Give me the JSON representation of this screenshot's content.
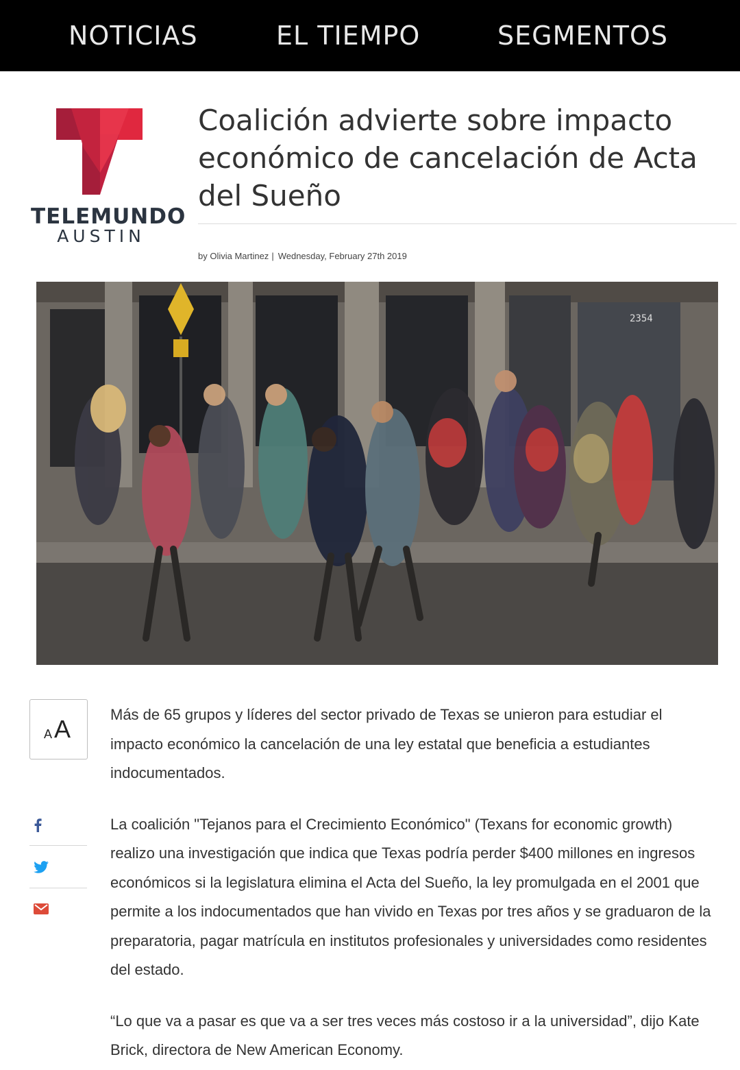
{
  "nav": {
    "items": [
      "NOTICIAS",
      "EL TIEMPO",
      "SEGMENTOS"
    ]
  },
  "brand": {
    "name": "TELEMUNDO",
    "city": "AUSTIN",
    "colors": {
      "dark_red": "#a51e3a",
      "red": "#e0283f",
      "text": "#2b3440"
    }
  },
  "article": {
    "title": "Coalición advierte sobre impacto económico de cancelación de Acta del Sueño",
    "author": "by Olivia Martinez",
    "date": "Wednesday, February 27th 2019",
    "paragraphs": [
      "Más de 65 grupos y líderes del sector privado de Texas se unieron para estudiar el impacto económico la cancelación de una ley estatal que beneficia a estudiantes indocumentados.",
      "La coalición \"Tejanos para el Crecimiento Económico\" (Texans for economic growth) realizo una investigación que indica que Texas podría perder $400 millones en ingresos económicos si la legislatura elimina el Acta del Sueño, la ley promulgada en el 2001 que permite a los indocumentados que han vivido en Texas por tres años y se graduaron de la preparatoria, pagar matrícula en institutos profesionales y universidades como residentes del estado.",
      "“Lo que va a pasar es que va a ser tres veces más costoso ir a la universidad”, dijo Kate Brick, directora de New American Economy."
    ]
  },
  "hero_photo": {
    "building_number": "2354"
  },
  "tools": {
    "font_size_small": "A",
    "font_size_big": "A"
  },
  "share": {
    "icons": [
      "facebook-icon",
      "twitter-icon",
      "email-icon"
    ],
    "colors": {
      "facebook": "#3b5998",
      "twitter": "#1da1f2",
      "email": "#dd4b39"
    }
  }
}
